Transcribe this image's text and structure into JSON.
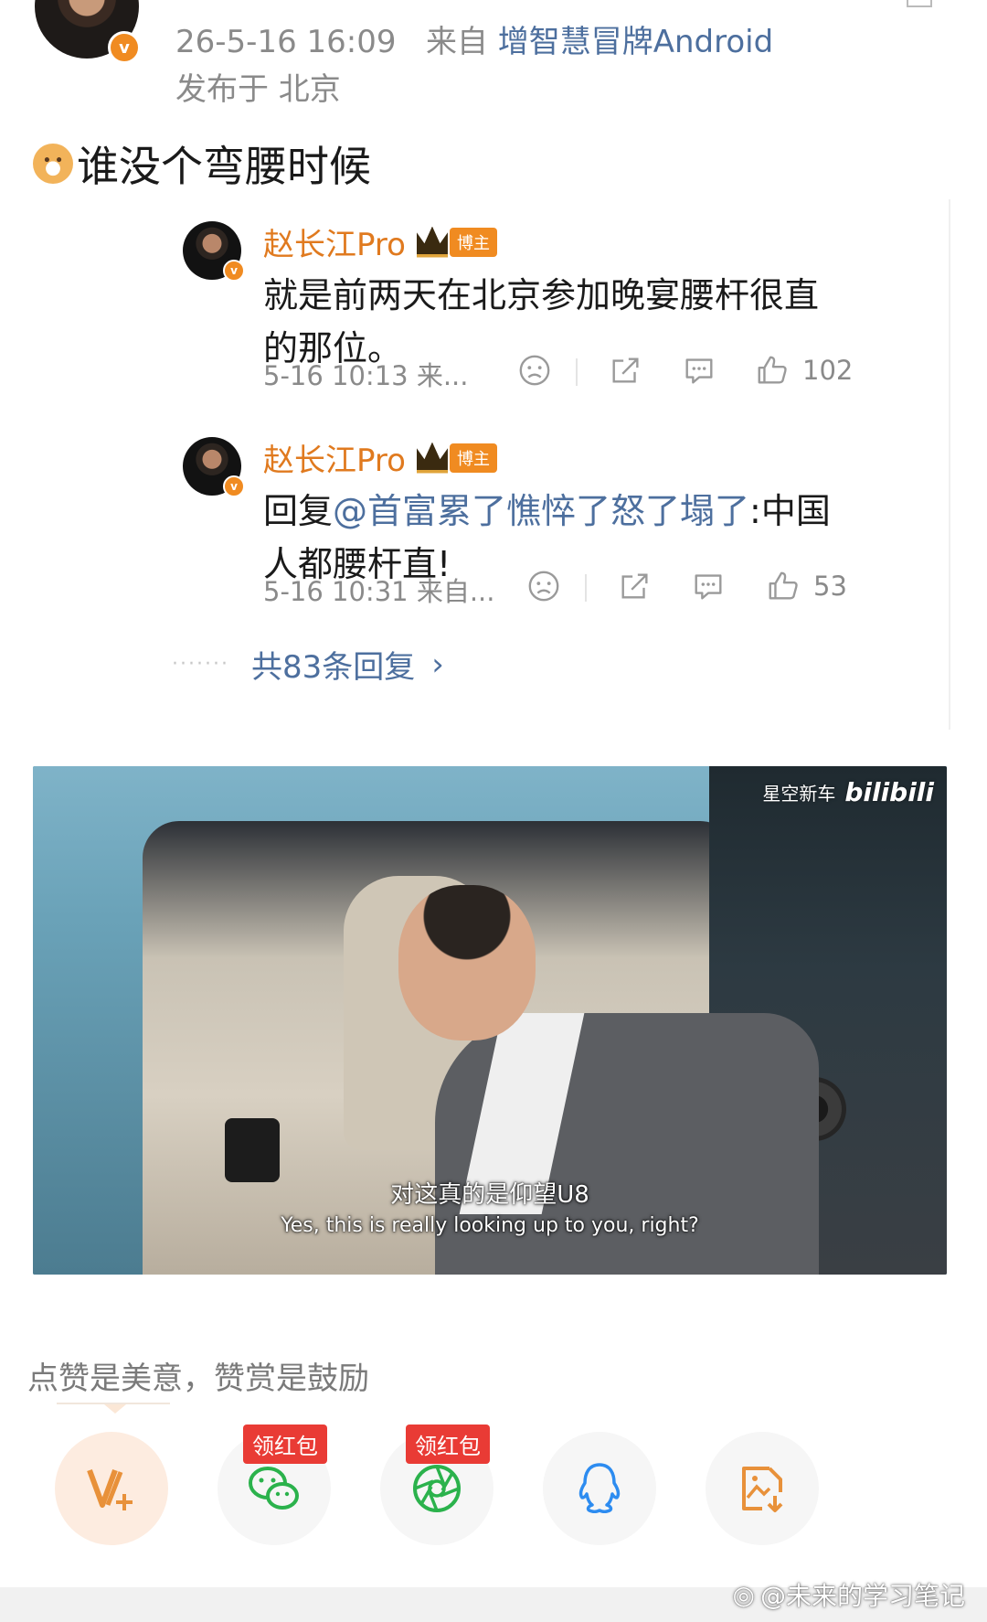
{
  "post": {
    "meta_time": "26-5-16 16:09",
    "meta_from": "来自",
    "meta_source": "增智慧冒牌Android",
    "location": "发布于 北京",
    "text": "谁没个弯腰时候",
    "verified_badge": "v"
  },
  "comments": [
    {
      "author": "赵长江Pro",
      "badge": "博主",
      "text": "就是前两天在北京参加晚宴腰杆很直的那位。",
      "time": "5-16 10:13 来...",
      "likes": "102",
      "icons": [
        "sad-face-icon",
        "share-icon",
        "comment-icon",
        "thumb-up-icon"
      ]
    },
    {
      "author": "赵长江Pro",
      "badge": "博主",
      "reply_prefix": "回复",
      "mention": "@首富累了憔悴了怒了塌了",
      "text_after": ":中国人都腰杆直!",
      "time": "5-16 10:31 来自...",
      "likes": "53",
      "icons": [
        "sad-face-icon",
        "share-icon",
        "comment-icon",
        "thumb-up-icon"
      ]
    }
  ],
  "more_replies": {
    "dots": "·······",
    "label": "共83条回复",
    "chevron": "›"
  },
  "photo": {
    "watermark_channel": "星空新车",
    "watermark_brand": "bilibili",
    "subtitle_cn": "对这真的是仰望U8",
    "subtitle_en": "Yes, this is really looking up to you, right?"
  },
  "reward": {
    "label": "点赞是美意，赞赏是鼓励",
    "red_packet_tag": "领红包",
    "buttons": [
      "v-plus-icon",
      "wechat-icon",
      "moments-icon",
      "qq-icon",
      "save-image-icon"
    ]
  },
  "footer": {
    "watermark": "@未来的学习笔记"
  },
  "colors": {
    "link_blue": "#4d6f9e",
    "author_orange": "#e07a1f",
    "red_tag": "#e93b35",
    "wechat_green": "#2bb24c"
  }
}
